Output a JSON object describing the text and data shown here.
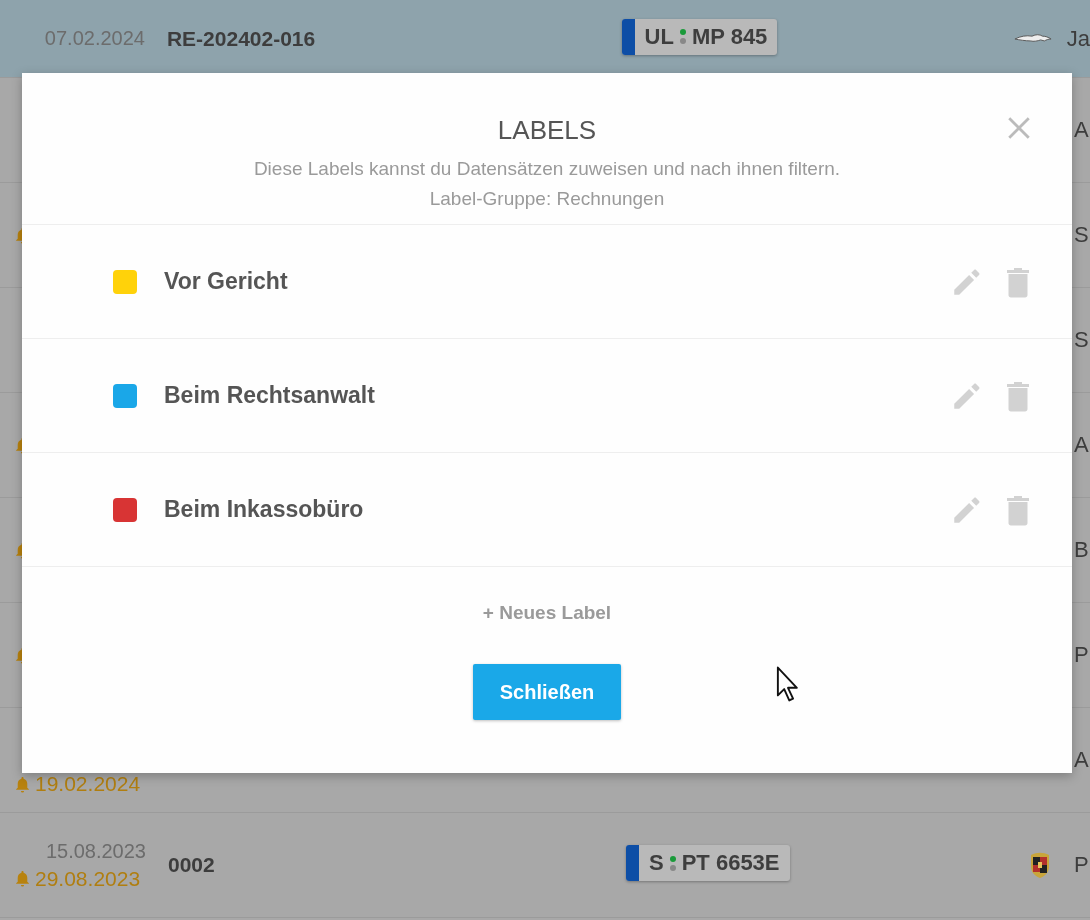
{
  "table": {
    "rows": [
      {
        "selected": true,
        "date": "07.02.2024",
        "number": "RE-202402-016",
        "plate": {
          "city": "UL",
          "letters": "MP 845"
        },
        "logo": {
          "kind": "cat"
        },
        "name": "Ja",
        "reminder": false
      },
      {
        "selected": false,
        "name": "A",
        "reminder": false
      },
      {
        "selected": false,
        "name": "S",
        "reminder": true
      },
      {
        "selected": false,
        "name": "S",
        "reminder": false
      },
      {
        "selected": false,
        "name": "A",
        "reminder": true
      },
      {
        "selected": false,
        "name": "B",
        "reminder": true
      },
      {
        "selected": false,
        "name": "P",
        "reminder": true
      },
      {
        "selected": false,
        "name": "A",
        "reminder": true,
        "due": "19.02.2024"
      },
      {
        "selected": false,
        "date": "15.08.2023",
        "due": "29.08.2023",
        "number": "0002",
        "plate": {
          "city": "S",
          "letters": "PT 6653E"
        },
        "logo": {
          "kind": "crest"
        },
        "name": "P",
        "reminder": true
      }
    ]
  },
  "dialog": {
    "title": "LABELS",
    "subtitle": "Diese Labels kannst du Datensätzen zuweisen und nach ihnen filtern.",
    "group": "Label-Gruppe: Rechnungen",
    "labels": [
      {
        "name": "Vor Gericht",
        "color": "#ffd20a"
      },
      {
        "name": "Beim Rechtsanwalt",
        "color": "#1aa7e8"
      },
      {
        "name": "Beim Inkassobüro",
        "color": "#d83434"
      }
    ],
    "add": "+ Neues Label",
    "close_button": "Schließen"
  }
}
